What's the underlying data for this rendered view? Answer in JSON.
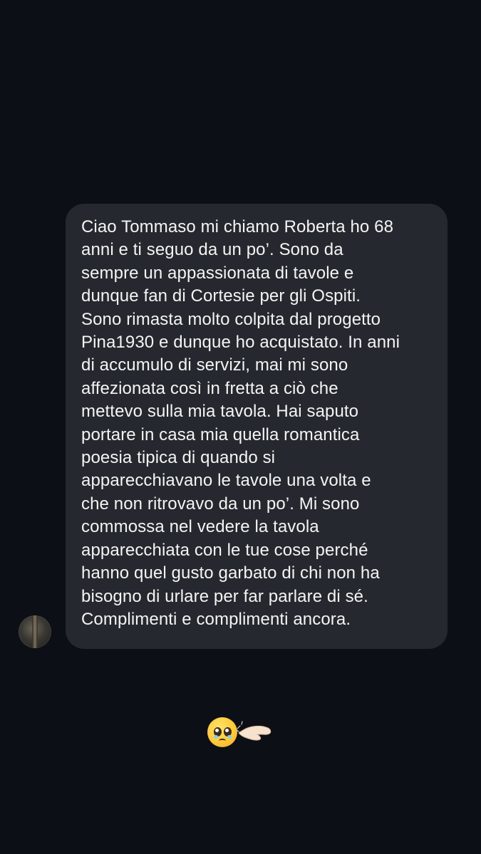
{
  "message": {
    "lines": [
      "Ciao Tommaso mi chiamo Roberta ho 68",
      "anni e ti seguo da un po’. Sono da",
      "sempre un appassionata di tavole e",
      "dunque fan di Cortesie per gli Ospiti.",
      "Sono rimasta molto colpita dal progetto",
      "Pina1930 e dunque ho acquistato. In anni",
      "di accumulo di servizi, mai mi sono",
      "affezionata così in fretta a ciò che",
      "mettevo sulla mia tavola. Hai saputo",
      "portare in casa mia quella romantica",
      "poesia tipica di quando si",
      "apparecchiavano le tavole una volta e",
      "che non ritrovavo da un po’. Mi sono",
      "commossa nel vedere la tavola",
      "apparecchiata con le tue cose perché",
      "hanno quel gusto garbato di chi non ha",
      "bisogno di urlare per far parlare di sé.",
      "Complimenti e complimenti ancora."
    ],
    "bubble_color": "#25282e",
    "text_color": "#f4f4f4"
  },
  "avatar": {
    "icon": "sender-avatar"
  },
  "reaction": {
    "icons": [
      "pleading-face-icon",
      "hand-icon"
    ]
  },
  "theme": {
    "background": "#0c0f15"
  }
}
